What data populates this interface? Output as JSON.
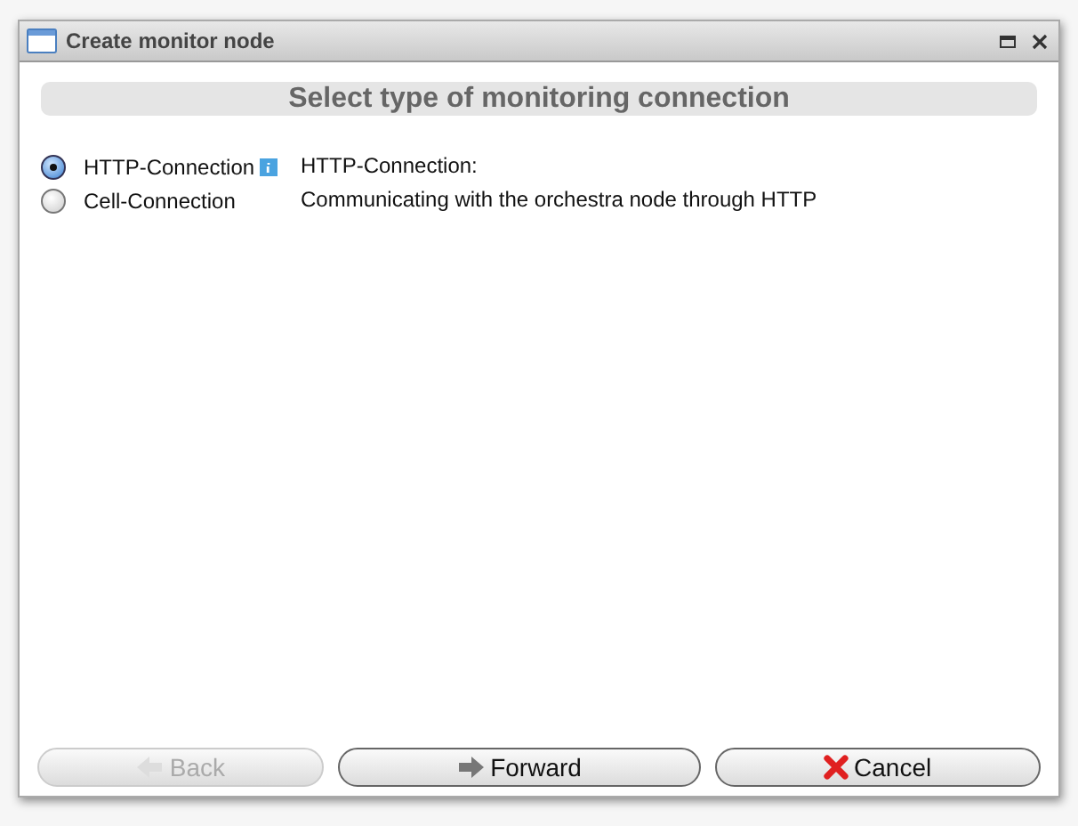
{
  "window": {
    "title": "Create monitor node"
  },
  "heading": "Select type of monitoring connection",
  "options": [
    {
      "label": "HTTP-Connection",
      "selected": true,
      "info": true
    },
    {
      "label": "Cell-Connection",
      "selected": false,
      "info": false
    }
  ],
  "description": [
    "HTTP-Connection:",
    "Communicating with the orchestra node through HTTP"
  ],
  "buttons": [
    {
      "label": "Back",
      "kind": "back",
      "disabled": true
    },
    {
      "label": "Forward",
      "kind": "forward",
      "disabled": false
    },
    {
      "label": "Cancel",
      "kind": "cancel",
      "disabled": false
    }
  ]
}
